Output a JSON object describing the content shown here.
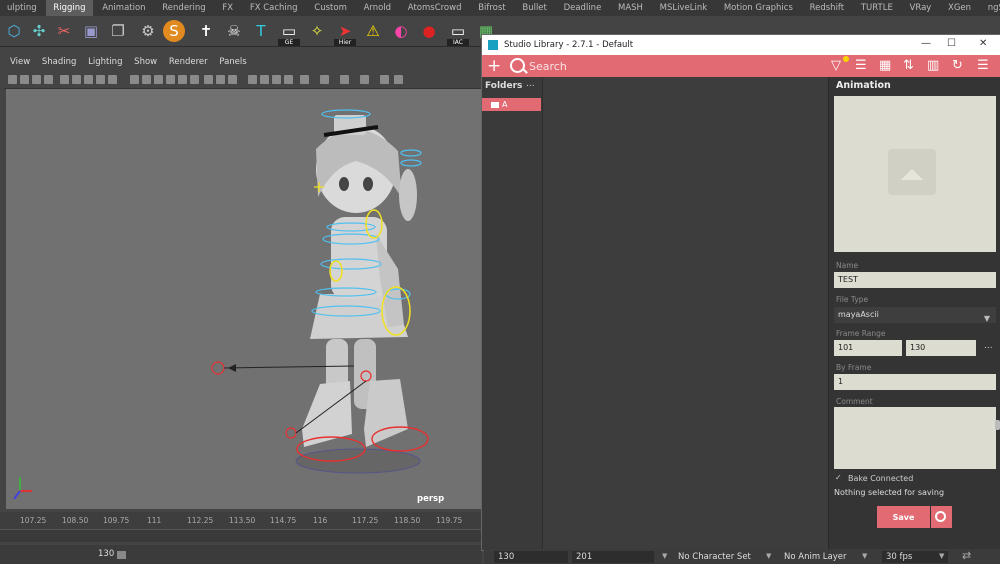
{
  "maya": {
    "shelf_tabs": [
      "ulpting",
      "Rigging",
      "Animation",
      "Rendering",
      "FX",
      "FX Caching",
      "Custom",
      "Arnold",
      "AtomsCrowd",
      "Bifrost",
      "Bullet",
      "Deadline",
      "MASH",
      "MSLiveLink",
      "Motion Graphics",
      "Redshift",
      "TURTLE",
      "VRay",
      "XGen",
      "ngSkinTo"
    ],
    "active_shelf_tab": "Rigging",
    "shelf_labels": {
      "ge": "GE",
      "hier": "Hier",
      "iac": "IAC"
    },
    "viewport_menu": [
      "View",
      "Shading",
      "Lighting",
      "Show",
      "Renderer",
      "Panels"
    ],
    "camera_label": "persp",
    "timeline_ticks": [
      "107.25",
      "108.50",
      "109.75",
      "111",
      "112.25",
      "113.50",
      "114.75",
      "116",
      "117.25",
      "118.50",
      "119.75"
    ],
    "current_frame": "130",
    "range_start": "130",
    "range_end": "201",
    "character_set": "No Character Set",
    "anim_layer": "No Anim Layer",
    "fps": "30 fps"
  },
  "studio_library": {
    "title": "Studio Library - 2.7.1 - Default",
    "search_placeholder": "Search",
    "folders_header": "Folders",
    "folders_more": "...",
    "folders": [
      {
        "name": "A"
      }
    ],
    "details": {
      "header": "Animation",
      "name_label": "Name",
      "name_value": "TEST",
      "file_type_label": "File Type",
      "file_type_value": "mayaAscii",
      "frame_range_label": "Frame Range",
      "frame_start": "101",
      "frame_end": "130",
      "frame_range_more": "...",
      "by_frame_label": "By Frame",
      "by_frame_value": "1",
      "comment_label": "Comment",
      "comment_value": "",
      "bake_label": "Bake Connected",
      "status_message": "Nothing selected for saving",
      "save_label": "Save"
    },
    "accent_color": "#e26b73"
  }
}
